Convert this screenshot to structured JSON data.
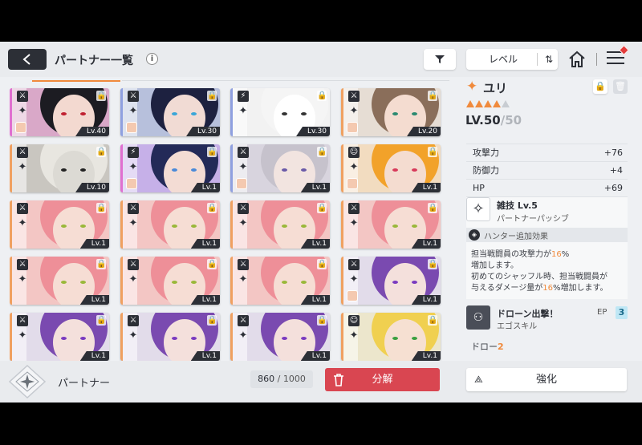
{
  "header": {
    "title": "パートナー一覧",
    "info_glyph": "i",
    "sort_label": "レベル",
    "sort_glyph": "⇅"
  },
  "cards": [
    {
      "level": "Lv.40",
      "stripe": "#e06fd0",
      "bg": "#d9a8c8",
      "hair": "#1c1c22",
      "skin": "#f3d9d0",
      "eye": "#c02030",
      "role": "⚔",
      "chibi": true
    },
    {
      "level": "Lv.30",
      "stripe": "#8fa0e0",
      "bg": "#b7c0dc",
      "hair": "#1d2140",
      "skin": "#f1dbd4",
      "eye": "#3aa6d8",
      "role": "⚔",
      "chibi": true
    },
    {
      "level": "Lv.30",
      "stripe": "#8fa0e0",
      "bg": "#f2f2f2",
      "hair": "#f5f5f5",
      "skin": "#ffffff",
      "eye": "#333333",
      "role": "⚡",
      "chibi": false
    },
    {
      "level": "Lv.20",
      "stripe": "#f0a060",
      "bg": "#e6ddd4",
      "hair": "#8a6e5a",
      "skin": "#f4dcd0",
      "eye": "#2a8a70",
      "role": "⚔",
      "chibi": true
    },
    {
      "level": "Lv.10",
      "stripe": "#f0a060",
      "bg": "#c9c6c0",
      "hair": "#e8e6e0",
      "skin": "#dcdad4",
      "eye": "#222222",
      "role": "⚔",
      "chibi": false
    },
    {
      "level": "Lv.1",
      "stripe": "#e06fd0",
      "bg": "#c6b0e8",
      "hair": "#232a58",
      "skin": "#f3dcd4",
      "eye": "#4a8ad8",
      "role": "⚡",
      "chibi": true
    },
    {
      "level": "Lv.1",
      "stripe": "#8fa0e0",
      "bg": "#d8d4de",
      "hair": "#c6c2cc",
      "skin": "#f2e4e0",
      "eye": "#6a5aa8",
      "role": "⚔",
      "chibi": true
    },
    {
      "level": "Lv.1",
      "stripe": "#f0a060",
      "bg": "#f2dcc0",
      "hair": "#f2a22a",
      "skin": "#f4dcd0",
      "eye": "#d83a5a",
      "role": "☺",
      "chibi": true
    },
    {
      "level": "Lv.1",
      "stripe": "#f0a060",
      "bg": "#f3c6c4",
      "hair": "#ee8f98",
      "skin": "#f6ddd4",
      "eye": "#9ab83a",
      "role": "⚔",
      "chibi": false
    },
    {
      "level": "Lv.1",
      "stripe": "#f0a060",
      "bg": "#f3c6c4",
      "hair": "#ee8f98",
      "skin": "#f6ddd4",
      "eye": "#9ab83a",
      "role": "⚔",
      "chibi": false
    },
    {
      "level": "Lv.1",
      "stripe": "#f0a060",
      "bg": "#f3c6c4",
      "hair": "#ee8f98",
      "skin": "#f6ddd4",
      "eye": "#9ab83a",
      "role": "⚔",
      "chibi": false
    },
    {
      "level": "Lv.1",
      "stripe": "#f0a060",
      "bg": "#f3c6c4",
      "hair": "#ee8f98",
      "skin": "#f6ddd4",
      "eye": "#9ab83a",
      "role": "⚔",
      "chibi": false
    },
    {
      "level": "Lv.1",
      "stripe": "#f0a060",
      "bg": "#f3c6c4",
      "hair": "#ee8f98",
      "skin": "#f6ddd4",
      "eye": "#9ab83a",
      "role": "⚔",
      "chibi": false
    },
    {
      "level": "Lv.1",
      "stripe": "#f0a060",
      "bg": "#f3c6c4",
      "hair": "#ee8f98",
      "skin": "#f6ddd4",
      "eye": "#9ab83a",
      "role": "⚔",
      "chibi": false
    },
    {
      "level": "Lv.1",
      "stripe": "#f0a060",
      "bg": "#f3c6c4",
      "hair": "#ee8f98",
      "skin": "#f6ddd4",
      "eye": "#9ab83a",
      "role": "⚔",
      "chibi": false
    },
    {
      "level": "Lv.1",
      "stripe": "#f0a060",
      "bg": "#e2dcea",
      "hair": "#7a4ab0",
      "skin": "#f4e0dc",
      "eye": "#7a3ac0",
      "role": "⚔",
      "chibi": true
    },
    {
      "level": "Lv.1",
      "stripe": "#f0a060",
      "bg": "#e2dcea",
      "hair": "#7a4ab0",
      "skin": "#f4e0dc",
      "eye": "#7a3ac0",
      "role": "⚔",
      "chibi": false
    },
    {
      "level": "Lv.1",
      "stripe": "#f0a060",
      "bg": "#e2dcea",
      "hair": "#7a4ab0",
      "skin": "#f4e0dc",
      "eye": "#7a3ac0",
      "role": "⚔",
      "chibi": false
    },
    {
      "level": "Lv.1",
      "stripe": "#f0a060",
      "bg": "#e2dcea",
      "hair": "#7a4ab0",
      "skin": "#f4e0dc",
      "eye": "#7a3ac0",
      "role": "⚔",
      "chibi": false
    },
    {
      "level": "Lv.1",
      "stripe": "#f0a060",
      "bg": "#ece6cc",
      "hair": "#f0d050",
      "skin": "#f6e0d2",
      "eye": "#3aa040",
      "role": "☺",
      "chibi": false
    }
  ],
  "detail": {
    "name": "ユリ",
    "stars_filled": 4,
    "stars_total": 5,
    "level_current": "LV.50",
    "level_max": "50",
    "stats": [
      {
        "label": "攻撃力",
        "value": "+76"
      },
      {
        "label": "防御力",
        "value": "+4"
      },
      {
        "label": "HP",
        "value": "+69"
      }
    ],
    "skill": {
      "name": "雑技 Lv.5",
      "type": "パートナーパッシブ",
      "hunter_label": "ハンター追加効果",
      "desc_line1_a": "担当戦闘員の攻撃力が",
      "desc_line1_hl": "16",
      "desc_line1_b": "%",
      "desc_line2": "増加します。",
      "desc_line3": "初めてのシャッフル時、担当戦闘員が",
      "desc_line4_a": "与えるダメージ量が",
      "desc_line4_hl": "16",
      "desc_line4_b": "%増加します。"
    },
    "ego": {
      "name": "ドローン出撃！",
      "type": "エゴスキル",
      "ep_label": "EP",
      "ep_value": "3"
    },
    "drone_label": "ドロー",
    "drone_value": "2"
  },
  "footer": {
    "partner_label": "パートナー",
    "count_current": "860",
    "count_sep": " / ",
    "count_max": "1000",
    "disassemble_label": "分解",
    "enhance_label": "強化"
  },
  "colors": {
    "accent": "#f08a3c",
    "danger": "#d94651",
    "dark": "#2c2f36"
  }
}
